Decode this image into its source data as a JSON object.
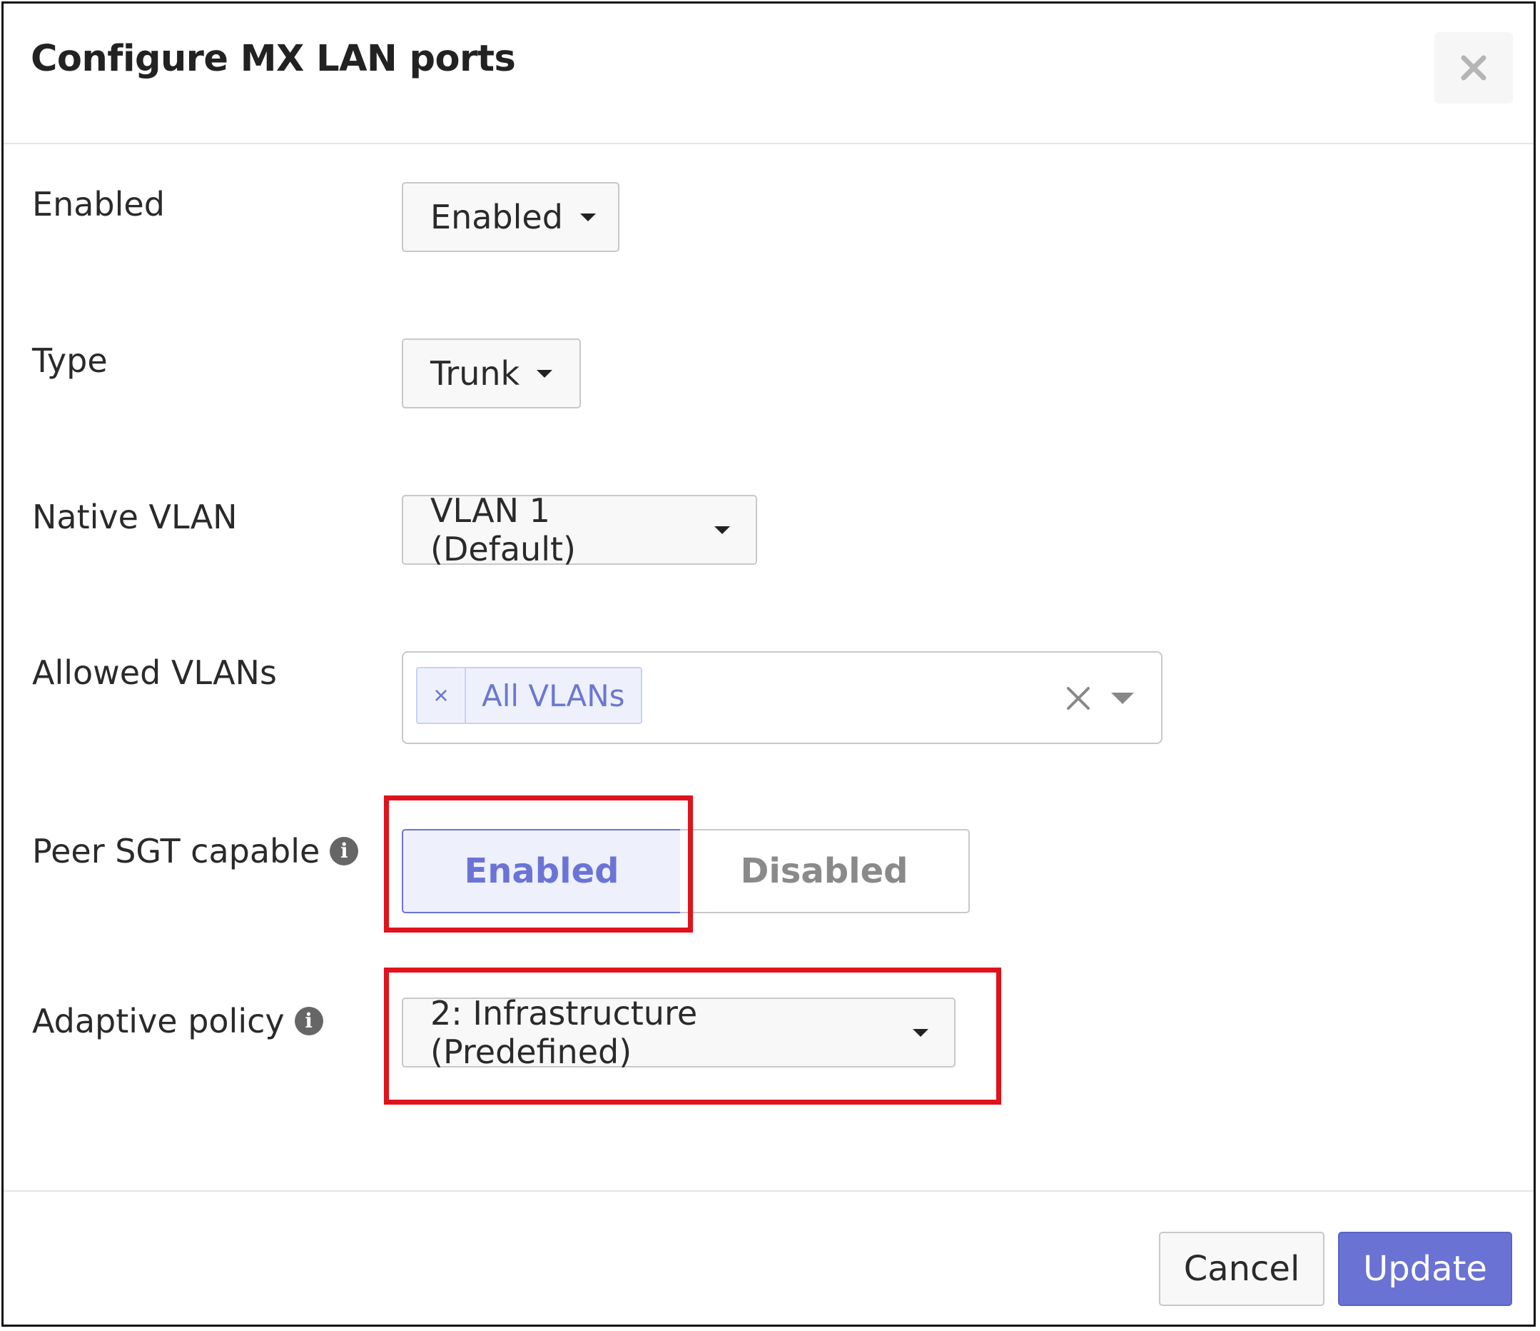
{
  "dialog": {
    "title": "Configure MX LAN ports",
    "close_icon": "close-icon"
  },
  "form": {
    "enabled": {
      "label": "Enabled",
      "value": "Enabled"
    },
    "type": {
      "label": "Type",
      "value": "Trunk"
    },
    "native_vlan": {
      "label": "Native VLAN",
      "value": "VLAN 1 (Default)"
    },
    "allowed_vlans": {
      "label": "Allowed VLANs",
      "tags": [
        "All VLANs"
      ]
    },
    "peer_sgt": {
      "label": "Peer SGT capable",
      "info_icon": "info-icon",
      "options": [
        "Enabled",
        "Disabled"
      ],
      "selected": "Enabled"
    },
    "adaptive_policy": {
      "label": "Adaptive policy",
      "info_icon": "info-icon",
      "value": "2: Infrastructure (Predefined)"
    }
  },
  "footer": {
    "cancel_label": "Cancel",
    "update_label": "Update"
  },
  "colors": {
    "accent": "#6a72d3",
    "highlight": "#e0121b",
    "tag_bg": "#eef1fc"
  }
}
